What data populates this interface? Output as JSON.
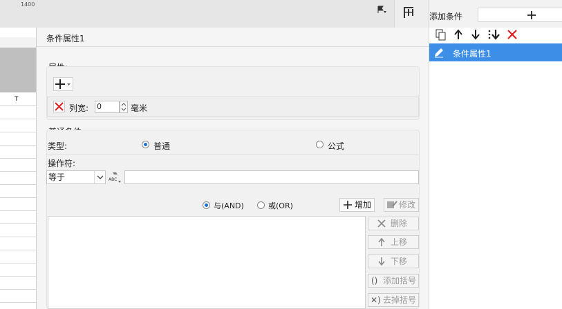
{
  "toolbar": {
    "flag_icon": "flag-dropdown-icon",
    "layout_icon": "column-layout-icon"
  },
  "sheet": {
    "ruler_label": "1400",
    "column_label": "T"
  },
  "dialog": {
    "title": "条件属性1",
    "property_section": {
      "label": "属性:",
      "add_icon": "plus-dropdown-icon"
    },
    "width_row": {
      "label": "列宽:",
      "value": "0",
      "unit": "毫米"
    },
    "general_section": {
      "label": "普通条件",
      "type_label": "类型:",
      "type_options": [
        {
          "label": "普通",
          "selected": true
        },
        {
          "label": "公式",
          "selected": false
        }
      ],
      "operator_label": "操作符:",
      "operator_value": "等于",
      "value_input": ""
    },
    "logic": {
      "and_label": "与(AND)",
      "or_label": "或(OR)",
      "and_selected": true,
      "add_label": "增加",
      "modify_label": "修改"
    },
    "side_buttons": {
      "delete": "删除",
      "move_up": "上移",
      "move_down": "下移",
      "add_bracket": "添加括号",
      "remove_bracket": "去掉括号"
    }
  },
  "right_panel": {
    "title": "添加条件",
    "list_items": [
      {
        "label": "条件属性1",
        "selected": true
      }
    ]
  },
  "colors": {
    "accent": "#3d8ee6",
    "delete_red": "#e02020",
    "radio_on": "#1a73d8"
  }
}
